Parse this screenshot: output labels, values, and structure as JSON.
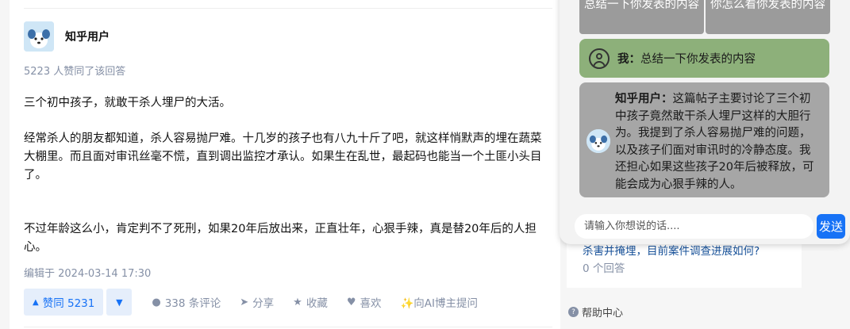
{
  "answer": {
    "author_name": "知乎用户",
    "upvote_info": "5223 人赞同了该回答",
    "paragraphs": [
      "三个初中孩子，就敢干杀人埋尸的大活。",
      "经常杀人的朋友都知道，杀人容易抛尸难。十几岁的孩子也有八九十斤了吧，就这样悄默声的埋在蔬菜大棚里。而且面对审讯丝毫不慌，直到调出监控才承认。如果生在乱世，最起码也能当一个土匪小头目了。",
      "不过年龄这么小，肯定判不了死刑，如果20年后放出来，正直壮年，心狠手辣，真是替20年后的人担心。"
    ],
    "edit_time": "编辑于 2024-03-14 17:30",
    "actions": {
      "upvote": "赞同 5231",
      "comments": "338 条评论",
      "share": "分享",
      "collect": "收藏",
      "like": "喜欢",
      "ask_ai": "✨向AI博主提问"
    }
  },
  "sidebar": {
    "related_question": "杀害并掩埋，目前案件调查进展如何?",
    "related_count": "0 个回答",
    "help_center": "帮助中心"
  },
  "chat": {
    "suggestions": [
      "总结一下你发表的内容",
      "你怎么看你发表的内容"
    ],
    "user_prefix": "我：",
    "user_message": "总结一下你发表的内容",
    "ai_prefix": "知乎用户：",
    "ai_message": "这篇帖子主要讨论了三个初中孩子竟然敢干杀人埋尸这样的大胆行为。我提到了杀人容易抛尸难的问题，以及孩子们面对审讯时的冷静态度。我还担心如果这些孩子20年后被释放，可能会成为心狠手辣的人。",
    "input_placeholder": "请输入你想说的话....",
    "send_label": "发送"
  },
  "colors": {
    "brand_blue": "#1772f6",
    "user_bubble": "#8db07a",
    "ai_bubble": "#a6a6a6",
    "suggestion_bg": "#9b9b9b",
    "muted_text": "#8590a6"
  },
  "icons": [
    "dog-avatar-icon",
    "triangle-up-icon",
    "triangle-down-icon",
    "comment-icon",
    "share-icon",
    "star-icon",
    "heart-icon",
    "user-icon",
    "help-icon"
  ]
}
